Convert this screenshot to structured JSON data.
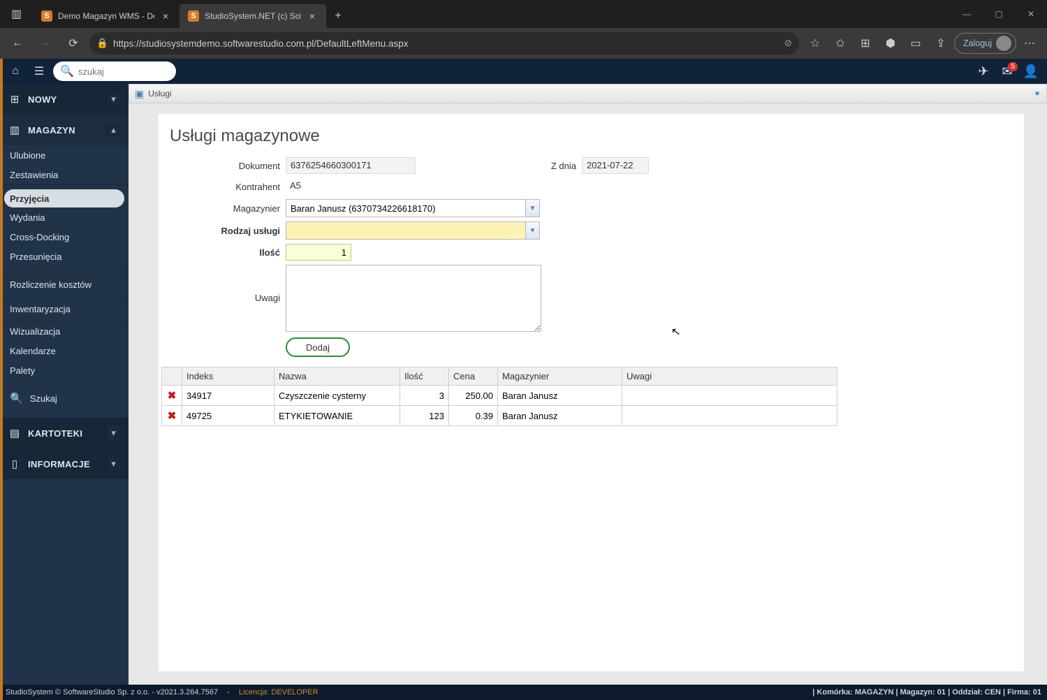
{
  "browser": {
    "tabs": [
      {
        "title": "Demo Magazyn WMS - Demo o"
      },
      {
        "title": "StudioSystem.NET (c) SoftwareSt"
      }
    ],
    "new_tab_tip": "+",
    "url": "https://studiosystemdemo.softwarestudio.com.pl/DefaultLeftMenu.aspx",
    "login_label": "Zaloguj",
    "win": {
      "min": "—",
      "max": "▢",
      "close": "✕"
    }
  },
  "topbar": {
    "search_placeholder": "szukaj",
    "mail_badge": "5"
  },
  "sidebar": {
    "sections": {
      "nowy": "NOWY",
      "magazyn": "MAGAZYN",
      "kartoteki": "KARTOTEKI",
      "informacje": "INFORMACJE"
    },
    "items_magazyn_top": [
      "Ulubione",
      "Zestawienia"
    ],
    "items_magazyn_mid": [
      "Przyjęcia",
      "Wydania",
      "Cross-Docking",
      "Przesunięcia"
    ],
    "items_magazyn_low": [
      "Rozliczenie kosztów"
    ],
    "items_magazyn_low2": [
      "Inwentaryzacja"
    ],
    "items_magazyn_low3": [
      "Wizualizacja",
      "Kalendarze",
      "Palety"
    ],
    "search_label": "Szukaj"
  },
  "panel": {
    "header": "Usługi"
  },
  "form": {
    "title": "Usługi magazynowe",
    "labels": {
      "dokument": "Dokument",
      "zdnia": "Z dnia",
      "kontrahent": "Kontrahent",
      "magazynier": "Magazynier",
      "rodzaj": "Rodzaj usługi",
      "ilosc": "Ilość",
      "uwagi": "Uwagi"
    },
    "values": {
      "dokument": "6376254660300171",
      "zdnia": "2021-07-22",
      "kontrahent": "A5",
      "magazynier": "Baran Janusz (6370734226618170)",
      "rodzaj": "",
      "ilosc": "1",
      "uwagi": ""
    },
    "button": "Dodaj"
  },
  "grid": {
    "headers": {
      "indeks": "Indeks",
      "nazwa": "Nazwa",
      "ilosc": "Ilość",
      "cena": "Cena",
      "magazynier": "Magazynier",
      "uwagi": "Uwagi"
    },
    "rows": [
      {
        "indeks": "34917",
        "nazwa": "Czyszczenie cysterny",
        "ilosc": "3",
        "cena": "250.00",
        "mag": "Baran Janusz",
        "uwagi": ""
      },
      {
        "indeks": "49725",
        "nazwa": "ETYKIETOWANIE",
        "ilosc": "123",
        "cena": "0.39",
        "mag": "Baran Janusz",
        "uwagi": ""
      }
    ]
  },
  "status": {
    "left": "StudioSystem © SoftwareStudio Sp. z o.o. - v2021.3.264.7567",
    "licencja_label": "Licencja:",
    "licencja_val": "DEVELOPER",
    "right": "| Komórka: MAGAZYN | Magazyn: 01 | Oddział: CEN | Firma: 01"
  }
}
